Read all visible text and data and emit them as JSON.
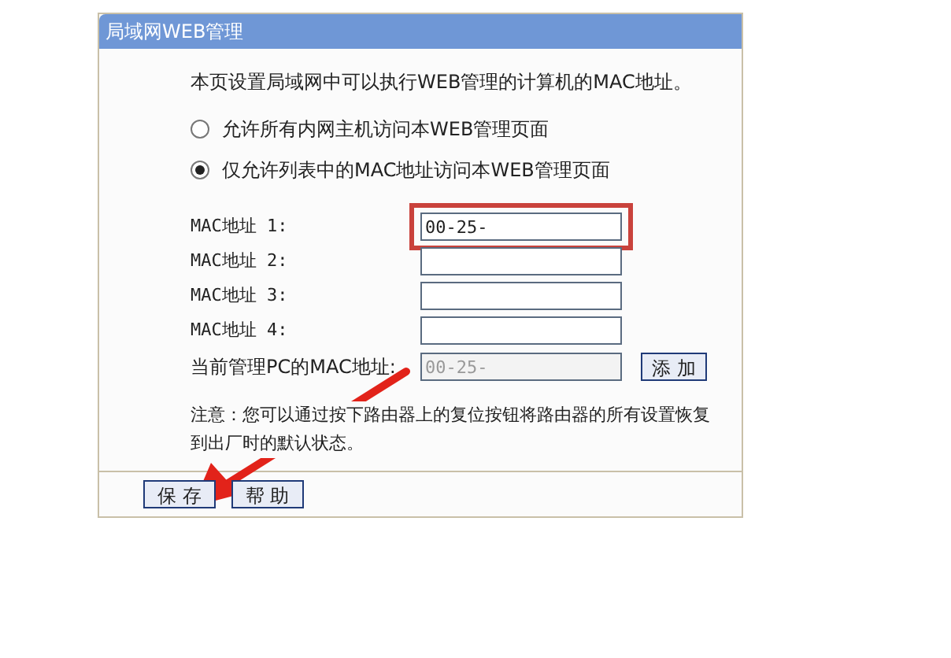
{
  "panel": {
    "title": "局域网WEB管理",
    "intro": "本页设置局域网中可以执行WEB管理的计算机的MAC地址。",
    "options": [
      {
        "label": "允许所有内网主机访问本WEB管理页面",
        "selected": false
      },
      {
        "label": "仅允许列表中的MAC地址访问本WEB管理页面",
        "selected": true
      }
    ],
    "mac_fields": [
      {
        "label": "MAC地址 1:",
        "value": "00-25-",
        "highlighted": true
      },
      {
        "label": "MAC地址 2:",
        "highlighted": false
      },
      {
        "label": "MAC地址 3:",
        "highlighted": false
      },
      {
        "label": "MAC地址 4:",
        "highlighted": false
      }
    ],
    "current_pc": {
      "label": "当前管理PC的MAC地址:",
      "value": "00-25-",
      "button": "添 加"
    },
    "note": "注意：您可以通过按下路由器上的复位按钮将路由器的所有设置恢复到出厂时的默认状态。",
    "buttons": [
      "保 存",
      "帮 助"
    ]
  }
}
